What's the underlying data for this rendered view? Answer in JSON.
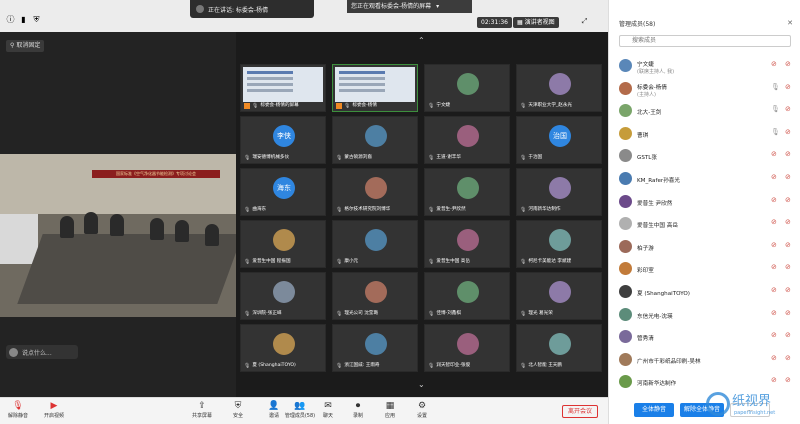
{
  "topbar": {
    "speaking": "正在讲话: 标委会-杨倩",
    "viewing": "您正在观看标委会-杨倩的屏幕",
    "timer": "02:31:36",
    "view_mode": "演讲者视图"
  },
  "stage": {
    "unpin_label": "取消固定",
    "chat_hint": "说点什么...",
    "banner_text": "国家标准《空气净化器节能检测》专项讨论会"
  },
  "gallery": {
    "tiles": [
      {
        "name": "标委会-杨倩的屏幕",
        "type": "screen",
        "host": true
      },
      {
        "name": "标委会-杨倩",
        "type": "screen",
        "host": true
      },
      {
        "name": "宁文婕",
        "type": "photo"
      },
      {
        "name": "天津职业大学_赵永光",
        "type": "photo"
      },
      {
        "name": "瑞安德博机械多伙",
        "type": "text",
        "avatar_text": "李侠"
      },
      {
        "name": "蒙古硕源刘裔",
        "type": "photo"
      },
      {
        "name": "王道-谢丰华",
        "type": "photo"
      },
      {
        "name": "于治国",
        "type": "text",
        "avatar_text": "治国"
      },
      {
        "name": "曲海东",
        "type": "text",
        "avatar_text": "海东"
      },
      {
        "name": "格尔技术研究院刘博华",
        "type": "photo"
      },
      {
        "name": "爱普生-尹欣然",
        "type": "photo"
      },
      {
        "name": "河南新华达制作",
        "type": "photo"
      },
      {
        "name": "爱普生中国 程振国",
        "type": "photo"
      },
      {
        "name": "康小元",
        "type": "photo"
      },
      {
        "name": "爱普生中国 高岳",
        "type": "photo"
      },
      {
        "name": "柯尼卡美能达 李斌建",
        "type": "photo"
      },
      {
        "name": "深圳院-张正崃",
        "type": "photo"
      },
      {
        "name": "理光公司 沈莹璐",
        "type": "photo"
      },
      {
        "name": "佳博-刘鑫棋",
        "type": "photo"
      },
      {
        "name": "理光 葛光荣",
        "type": "photo"
      },
      {
        "name": "夏 (ShanghaiTOYO)",
        "type": "photo"
      },
      {
        "name": "浙江国威: 王雨奇",
        "type": "photo"
      },
      {
        "name": "润天智印业-张俊",
        "type": "photo"
      },
      {
        "name": "北人智能 王天鹏",
        "type": "photo"
      }
    ]
  },
  "participants": {
    "title": "管理成员(58)",
    "search_placeholder": "搜索成员",
    "list": [
      {
        "name": "宁文婕",
        "role": "(联席主持人, 我)",
        "mic_on": false
      },
      {
        "name": "标委会-杨倩",
        "role": "(主持人)",
        "mic_on": true
      },
      {
        "name": "北大-王剑",
        "role": "",
        "mic_on": true
      },
      {
        "name": "曹琪",
        "role": "",
        "mic_on": true
      },
      {
        "name": "GSTL张",
        "role": "",
        "mic_on": false
      },
      {
        "name": "KM_Rafer孙喜光",
        "role": "",
        "mic_on": false
      },
      {
        "name": "爱普生 尹欣然",
        "role": "",
        "mic_on": false
      },
      {
        "name": "爱普生中国 高岳",
        "role": "",
        "mic_on": false
      },
      {
        "name": "柏子游",
        "role": "",
        "mic_on": false
      },
      {
        "name": "彩印室",
        "role": "",
        "mic_on": false
      },
      {
        "name": "夏 (ShanghaiTOYO)",
        "role": "",
        "mic_on": false
      },
      {
        "name": "东信光电-沈瑛",
        "role": "",
        "mic_on": false
      },
      {
        "name": "管秀清",
        "role": "",
        "mic_on": false
      },
      {
        "name": "广州市千彩纸品印刷-吴林",
        "role": "",
        "mic_on": false
      },
      {
        "name": "河南新华达制作",
        "role": "",
        "mic_on": false
      }
    ],
    "mute_all": "全体静音",
    "unmute_all": "解除全体静音",
    "more": "..."
  },
  "toolbar": {
    "buttons": [
      {
        "label": "解除静音",
        "icon": "mic-off-icon"
      },
      {
        "label": "开启视频",
        "icon": "camera-off-icon"
      },
      {
        "label": "共享屏幕",
        "icon": "share-icon"
      },
      {
        "label": "安全",
        "icon": "shield-icon"
      },
      {
        "label": "邀请",
        "icon": "invite-icon"
      },
      {
        "label": "管理成员(58)",
        "icon": "members-icon"
      },
      {
        "label": "聊天",
        "icon": "chat-icon"
      },
      {
        "label": "录制",
        "icon": "record-icon"
      },
      {
        "label": "应用",
        "icon": "apps-icon"
      },
      {
        "label": "设置",
        "icon": "settings-icon"
      }
    ],
    "leave": "离开会议"
  },
  "watermark": {
    "text": "纸视界",
    "url": "paperinsight.net"
  }
}
